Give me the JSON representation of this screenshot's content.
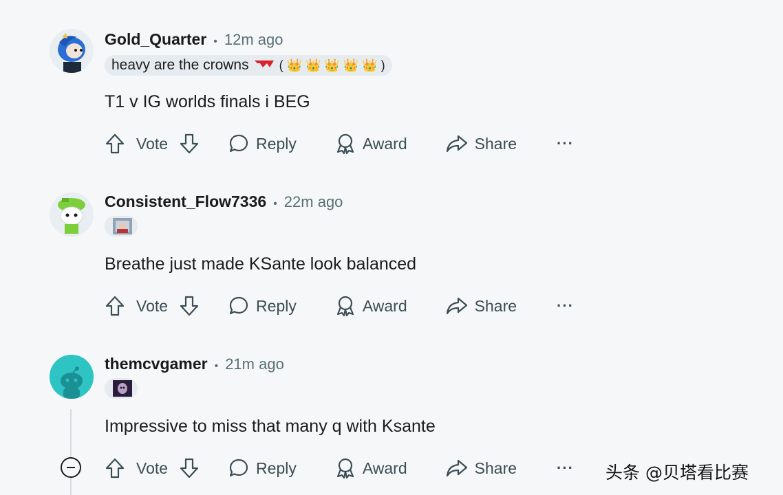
{
  "comments": [
    {
      "username": "Gold_Quarter",
      "time": "12m ago",
      "flair_text": "heavy are the crowns",
      "flair_extra": "( 👑 👑 👑 👑 👑 )",
      "body": "T1 v IG worlds finals i BEG",
      "actions": {
        "vote": "Vote",
        "reply": "Reply",
        "award": "Award",
        "share": "Share",
        "more": "···"
      }
    },
    {
      "username": "Consistent_Flow7336",
      "time": "22m ago",
      "body": "Breathe just made KSante look balanced",
      "actions": {
        "vote": "Vote",
        "reply": "Reply",
        "award": "Award",
        "share": "Share",
        "more": "···"
      }
    },
    {
      "username": "themcvgamer",
      "time": "21m ago",
      "body": "Impressive to miss that many q with Ksante",
      "actions": {
        "vote": "Vote",
        "reply": "Reply",
        "award": "Award",
        "share": "Share",
        "more": "···"
      }
    }
  ],
  "separator": "•",
  "watermark": "头条 @贝塔看比赛",
  "colors": {
    "background": "#f6f7f8",
    "muted": "#576f76",
    "flair_bg": "#e5ebee",
    "avatar_teal": "#2ec4c4"
  }
}
